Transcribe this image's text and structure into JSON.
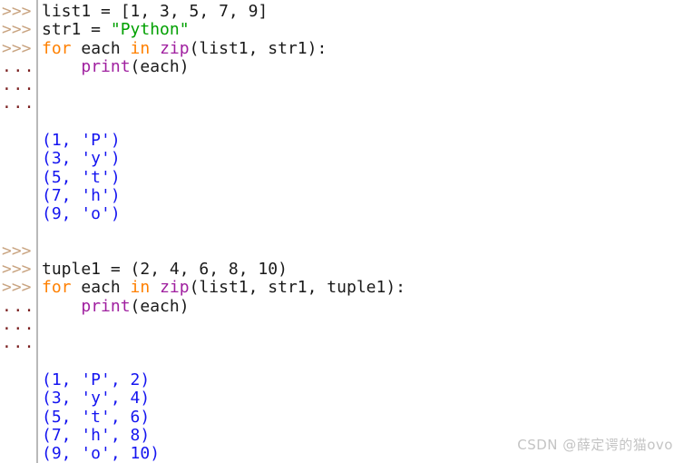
{
  "console": {
    "prompt_primary": ">>>",
    "prompt_secondary": "...",
    "colors": {
      "background": "#ffffff",
      "default_text": "#1a1a1a",
      "prompt_primary": "#c9a481",
      "prompt_secondary": "#7a1f1f",
      "keyword": "#ff8000",
      "builtin": "#a020a0",
      "string": "#00a000",
      "output": "#1515f0",
      "gutter_rule": "#b9b9b9",
      "watermark": "#c4c4c4"
    },
    "lines": [
      {
        "gutter": ">>>",
        "gutter_kind": "ps1",
        "tokens": [
          {
            "text": "list1 = [1, 3, 5, 7, 9]",
            "cls": "tok-plain"
          }
        ]
      },
      {
        "gutter": ">>>",
        "gutter_kind": "ps1",
        "tokens": [
          {
            "text": "str1 = ",
            "cls": "tok-plain"
          },
          {
            "text": "\"Python\"",
            "cls": "tok-string"
          }
        ]
      },
      {
        "gutter": ">>>",
        "gutter_kind": "ps1",
        "tokens": [
          {
            "text": "for",
            "cls": "tok-keyword"
          },
          {
            "text": " each ",
            "cls": "tok-plain"
          },
          {
            "text": "in",
            "cls": "tok-keyword"
          },
          {
            "text": " ",
            "cls": "tok-plain"
          },
          {
            "text": "zip",
            "cls": "tok-builtin"
          },
          {
            "text": "(list1, str1):",
            "cls": "tok-plain"
          }
        ]
      },
      {
        "gutter": "...",
        "gutter_kind": "ps2",
        "tokens": [
          {
            "text": "    ",
            "cls": "tok-plain"
          },
          {
            "text": "print",
            "cls": "tok-builtin"
          },
          {
            "text": "(each)",
            "cls": "tok-plain"
          }
        ]
      },
      {
        "gutter": "...",
        "gutter_kind": "ps2",
        "tokens": []
      },
      {
        "gutter": "...",
        "gutter_kind": "ps2",
        "tokens": []
      },
      {
        "gutter": "",
        "gutter_kind": "none",
        "tokens": []
      },
      {
        "gutter": "",
        "gutter_kind": "none",
        "tokens": [
          {
            "text": "(1, 'P')",
            "cls": "tok-output"
          }
        ]
      },
      {
        "gutter": "",
        "gutter_kind": "none",
        "tokens": [
          {
            "text": "(3, 'y')",
            "cls": "tok-output"
          }
        ]
      },
      {
        "gutter": "",
        "gutter_kind": "none",
        "tokens": [
          {
            "text": "(5, 't')",
            "cls": "tok-output"
          }
        ]
      },
      {
        "gutter": "",
        "gutter_kind": "none",
        "tokens": [
          {
            "text": "(7, 'h')",
            "cls": "tok-output"
          }
        ]
      },
      {
        "gutter": "",
        "gutter_kind": "none",
        "tokens": [
          {
            "text": "(9, 'o')",
            "cls": "tok-output"
          }
        ]
      },
      {
        "gutter": "",
        "gutter_kind": "none",
        "tokens": []
      },
      {
        "gutter": ">>>",
        "gutter_kind": "ps1",
        "tokens": []
      },
      {
        "gutter": ">>>",
        "gutter_kind": "ps1",
        "tokens": [
          {
            "text": "tuple1 = (2, 4, 6, 8, 10)",
            "cls": "tok-plain"
          }
        ]
      },
      {
        "gutter": ">>>",
        "gutter_kind": "ps1",
        "tokens": [
          {
            "text": "for",
            "cls": "tok-keyword"
          },
          {
            "text": " each ",
            "cls": "tok-plain"
          },
          {
            "text": "in",
            "cls": "tok-keyword"
          },
          {
            "text": " ",
            "cls": "tok-plain"
          },
          {
            "text": "zip",
            "cls": "tok-builtin"
          },
          {
            "text": "(list1, str1, tuple1):",
            "cls": "tok-plain"
          }
        ]
      },
      {
        "gutter": "...",
        "gutter_kind": "ps2",
        "tokens": [
          {
            "text": "    ",
            "cls": "tok-plain"
          },
          {
            "text": "print",
            "cls": "tok-builtin"
          },
          {
            "text": "(each)",
            "cls": "tok-plain"
          }
        ]
      },
      {
        "gutter": "...",
        "gutter_kind": "ps2",
        "tokens": []
      },
      {
        "gutter": "...",
        "gutter_kind": "ps2",
        "tokens": []
      },
      {
        "gutter": "",
        "gutter_kind": "none",
        "tokens": []
      },
      {
        "gutter": "",
        "gutter_kind": "none",
        "tokens": [
          {
            "text": "(1, 'P', 2)",
            "cls": "tok-output"
          }
        ]
      },
      {
        "gutter": "",
        "gutter_kind": "none",
        "tokens": [
          {
            "text": "(3, 'y', 4)",
            "cls": "tok-output"
          }
        ]
      },
      {
        "gutter": "",
        "gutter_kind": "none",
        "tokens": [
          {
            "text": "(5, 't', 6)",
            "cls": "tok-output"
          }
        ]
      },
      {
        "gutter": "",
        "gutter_kind": "none",
        "tokens": [
          {
            "text": "(7, 'h', 8)",
            "cls": "tok-output"
          }
        ]
      },
      {
        "gutter": "",
        "gutter_kind": "none",
        "tokens": [
          {
            "text": "(9, 'o', 10)",
            "cls": "tok-output"
          }
        ]
      }
    ]
  },
  "watermark": {
    "text": "CSDN @薛定谔的猫ovo"
  }
}
